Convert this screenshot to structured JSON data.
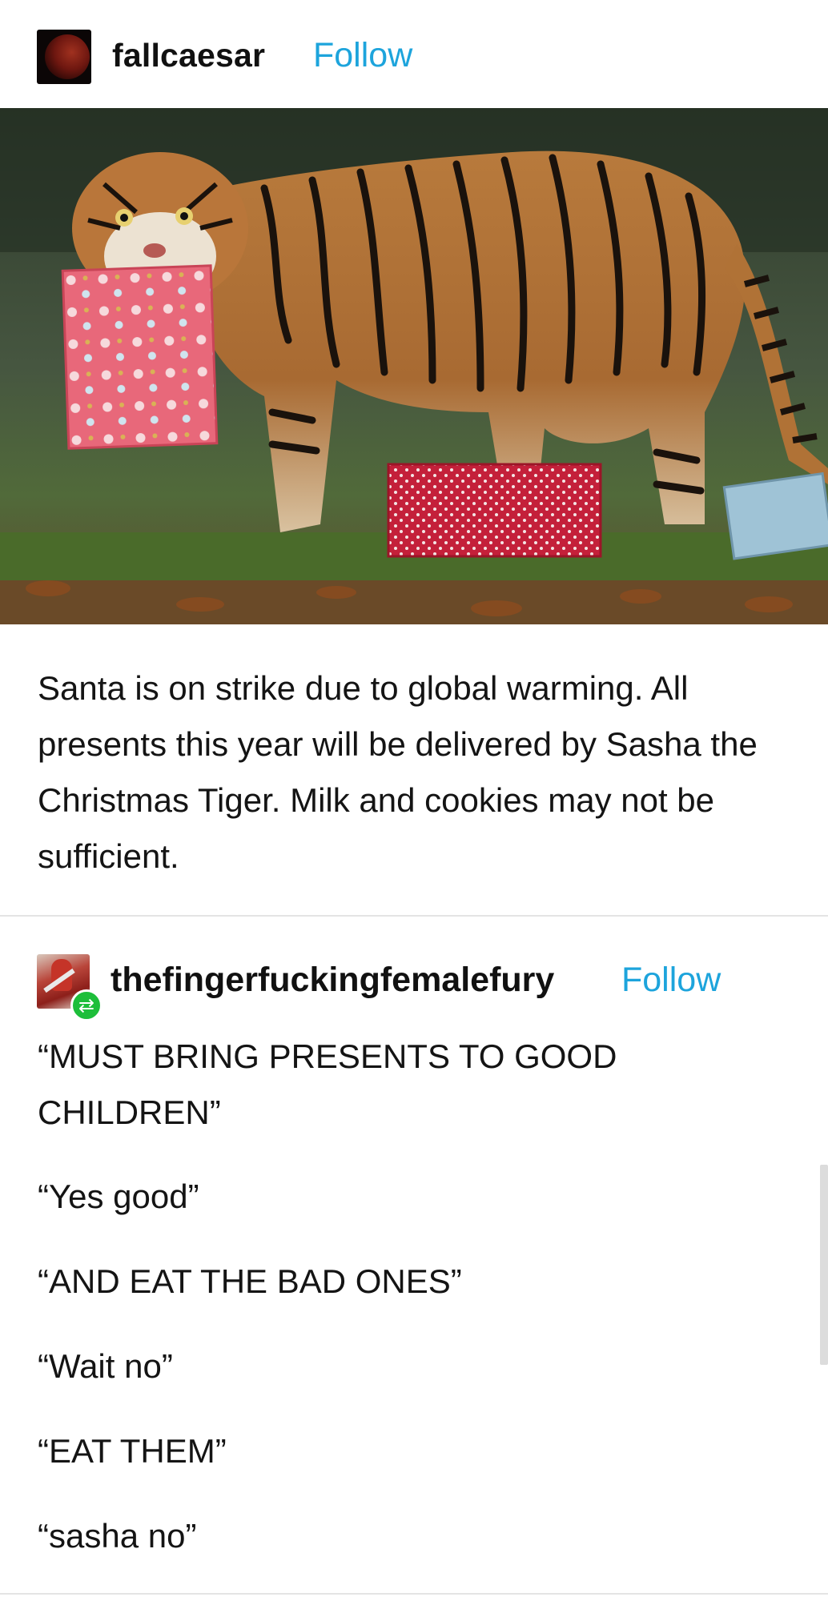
{
  "post": {
    "blog_name": "fallcaesar",
    "follow_label": "Follow",
    "avatar_icon": "blood-moon-avatar",
    "caption": "Santa is on strike due to global warming.  All presents this year will be delivered by Sasha the Christmas Tiger.  Milk and cookies may not be sufficient."
  },
  "reblog": {
    "blog_name": "thefingerfuckingfemalefury",
    "follow_label": "Follow",
    "avatar_icon": "character-avatar",
    "badge_icon": "reblog-icon",
    "badge_glyph": "⇄",
    "quotes": [
      "“MUST BRING PRESENTS TO GOOD CHILDREN”",
      "“Yes good”",
      "“AND EAT THE BAD ONES”",
      "“Wait no”",
      "“EAT THEM”",
      "“sasha no”"
    ]
  },
  "colors": {
    "follow": "#1da4dc",
    "reblog_badge": "#1dbe3a",
    "divider": "#e4e4e4"
  }
}
